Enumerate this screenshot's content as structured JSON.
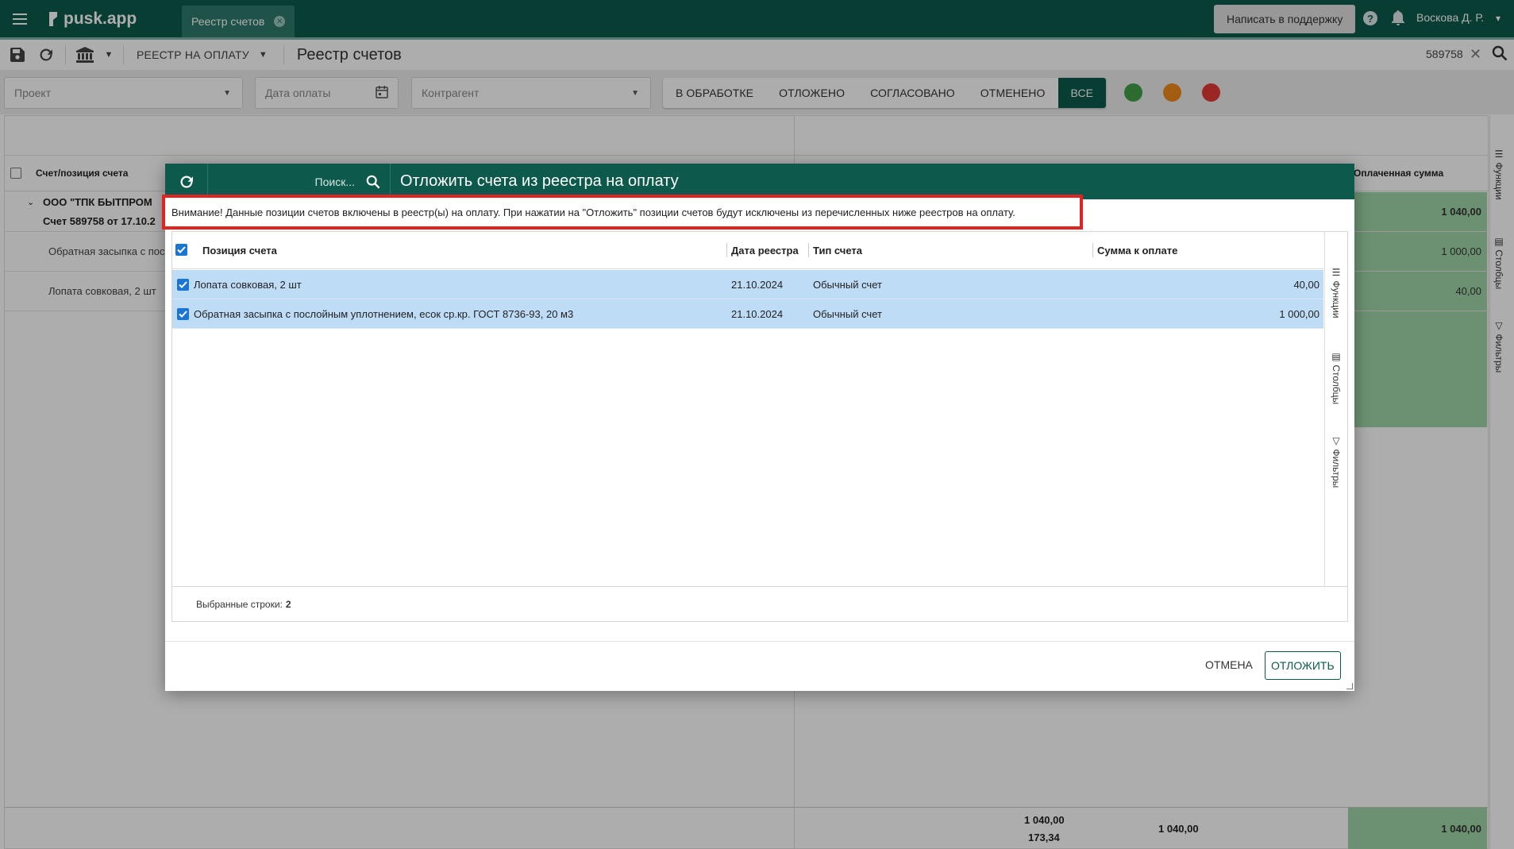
{
  "app": {
    "logo_text": "pusk.app",
    "tab_label": "Реестр счетов",
    "support_button": "Написать в поддержку",
    "user_name": "Воскова Д. Р."
  },
  "toolbar": {
    "registry_select": "РЕЕСТР НА ОПЛАТУ",
    "page_title": "Реестр счетов",
    "doc_id": "589758"
  },
  "filters": {
    "project_placeholder": "Проект",
    "date_placeholder": "Дата оплаты",
    "counterparty_placeholder": "Контрагент",
    "statuses": [
      "В ОБРАБОТКЕ",
      "ОТЛОЖЕНО",
      "СОГЛАСОВАНО",
      "ОТМЕНЕНО",
      "ВСЕ"
    ],
    "active_status": "ВСЕ",
    "status_colors": [
      "#43a047",
      "#ef8a1a",
      "#e53935"
    ]
  },
  "grid": {
    "col_position": "Счет/позиция счета",
    "col_paid": "Оплаченная сумма",
    "group_title": "ООО \"ТПК БЫТПРОМ",
    "group_subtitle": "Счет 589758 от 17.10.2",
    "rows": [
      {
        "name": "Обратная засыпка с пос",
        "paid": "1 000,00"
      },
      {
        "name": "Лопата совковая, 2 шт",
        "paid": "40,00"
      }
    ],
    "group_paid": "1 040,00",
    "footer": {
      "total_a": "1 040,00",
      "total_b": "173,34",
      "total_c": "1 040,00",
      "total_paid": "1 040,00"
    },
    "rail": [
      "Функции",
      "Столбцы",
      "Фильтры"
    ]
  },
  "dialog": {
    "search_placeholder": "Поиск...",
    "title": "Отложить счета из реестра на оплату",
    "warning": "Внимание! Данные позиции счетов включены в реестр(ы) на оплату. При нажатии на \"Отложить\" позиции счетов будут исключены из перечисленных ниже реестров на оплату.",
    "columns": [
      "Позиция счета",
      "Дата реестра",
      "Тип счета",
      "Сумма к оплате"
    ],
    "rows": [
      {
        "position": "Лопата совковая, 2 шт",
        "date": "21.10.2024",
        "type": "Обычный счет",
        "amount": "40,00"
      },
      {
        "position": "Обратная засыпка с послойным уплотнением, есок ср.кр. ГОСТ 8736-93, 20 м3",
        "date": "21.10.2024",
        "type": "Обычный счет",
        "amount": "1 000,00"
      }
    ],
    "rail": [
      "Функции",
      "Столбцы",
      "Фильтры"
    ],
    "selected_label": "Выбранные строки:",
    "selected_count": "2",
    "cancel_button": "ОТМЕНА",
    "postpone_button": "ОТЛОЖИТЬ"
  }
}
